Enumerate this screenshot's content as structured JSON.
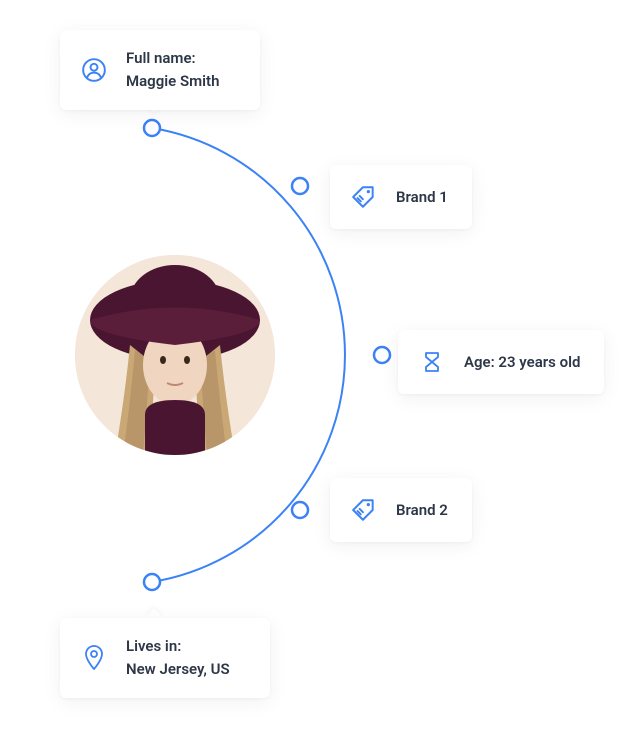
{
  "profile": {
    "fullname_label": "Full name:",
    "fullname_value": "Maggie Smith",
    "brand1_label": "Brand 1",
    "age_label": "Age: 23 years old",
    "brand2_label": "Brand 2",
    "lives_label": "Lives in:",
    "lives_value": "New Jersey, US"
  },
  "colors": {
    "accent": "#3b82f6",
    "text": "#2d3748",
    "bg": "#ffffff"
  },
  "icons": {
    "person": "person-icon",
    "tag": "tag-icon",
    "hourglass": "hourglass-icon",
    "pin": "pin-icon"
  }
}
